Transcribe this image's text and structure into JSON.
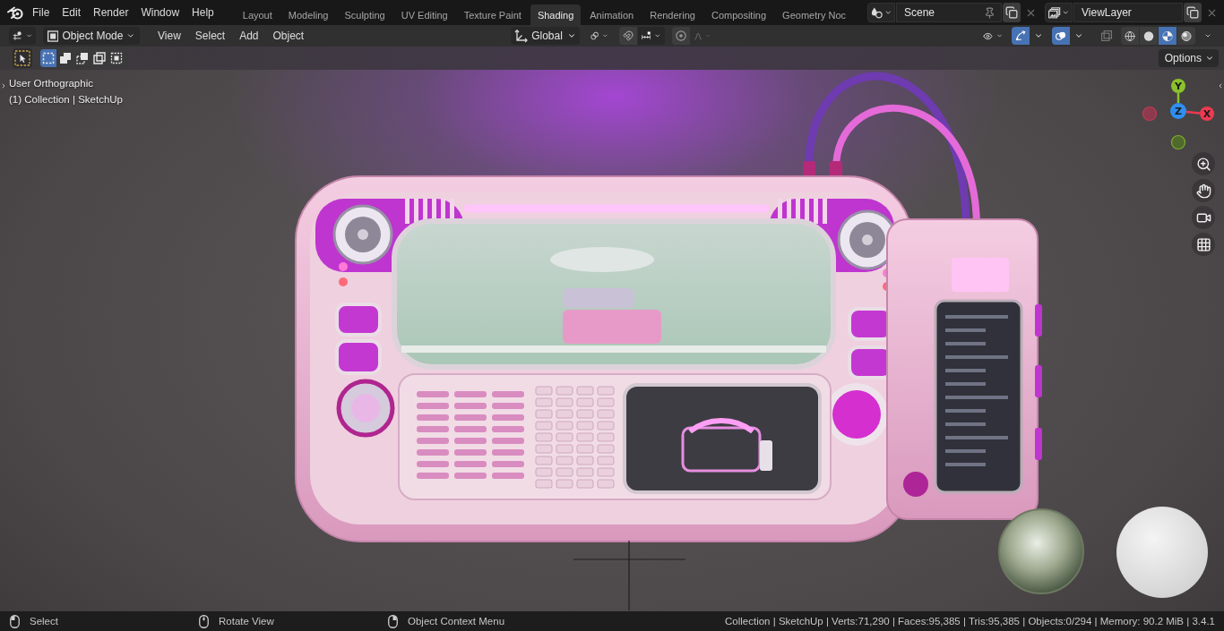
{
  "menu_bar": {
    "menus": [
      "File",
      "Edit",
      "Render",
      "Window",
      "Help"
    ]
  },
  "workspaces": [
    {
      "label": "Layout",
      "selected": false
    },
    {
      "label": "Modeling",
      "selected": false
    },
    {
      "label": "Sculpting",
      "selected": false
    },
    {
      "label": "UV Editing",
      "selected": false
    },
    {
      "label": "Texture Paint",
      "selected": false
    },
    {
      "label": "Shading",
      "selected": true
    },
    {
      "label": "Animation",
      "selected": false
    },
    {
      "label": "Rendering",
      "selected": false
    },
    {
      "label": "Compositing",
      "selected": false
    },
    {
      "label": "Geometry Noc",
      "selected": false
    }
  ],
  "scene_selector": {
    "value": "Scene"
  },
  "view_layer_selector": {
    "value": "ViewLayer"
  },
  "header": {
    "mode": "Object Mode",
    "menus": [
      "View",
      "Select",
      "Add",
      "Object"
    ],
    "transform_orientation": "Global",
    "gizmos_on": true,
    "overlays_on": true,
    "xray_on": false,
    "shading_modes": [
      {
        "kind": "wireframe",
        "selected": false
      },
      {
        "kind": "solid",
        "selected": false
      },
      {
        "kind": "material",
        "selected": true
      },
      {
        "kind": "rendered",
        "selected": false
      }
    ]
  },
  "tool_header": {
    "selection_modes": [
      {
        "kind": "set",
        "selected": true
      },
      {
        "kind": "extend",
        "selected": false
      },
      {
        "kind": "subtract",
        "selected": false
      },
      {
        "kind": "difference",
        "selected": false
      },
      {
        "kind": "intersect",
        "selected": false
      }
    ],
    "options": "Options"
  },
  "viewport": {
    "view_name": "User Orthographic",
    "object_info": "(1) Collection | SketchUp",
    "axes": [
      {
        "label": "Y",
        "color": "#8ac22b"
      },
      {
        "label": "Z",
        "color": "#2e8ff0"
      },
      {
        "label": "X",
        "color": "#ee3a52"
      }
    ]
  },
  "status_bar": {
    "hints": [
      {
        "label": "Select",
        "kind": "left"
      },
      {
        "label": "Rotate View",
        "kind": "middle"
      },
      {
        "label": "Object Context Menu",
        "kind": "right"
      }
    ],
    "stats": "Collection | SketchUp | Verts:71,290 | Faces:95,385 | Tris:95,385 | Objects:0/294 | Memory: 90.2 MiB | 3.4.1"
  }
}
